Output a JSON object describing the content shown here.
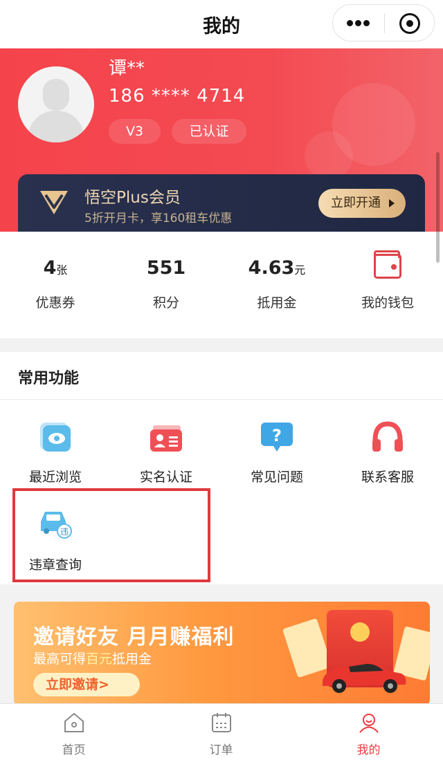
{
  "nav": {
    "title": "我的",
    "more_icon": "more-dots-icon",
    "close_icon": "target-circle-icon"
  },
  "profile": {
    "name": "谭**",
    "phone": "186 **** 4714",
    "level": "V3",
    "verified": "已认证"
  },
  "plus": {
    "title": "悟空Plus会员",
    "subtitle": "5折开月卡，享160租车优惠",
    "button": "立即开通"
  },
  "stats": [
    {
      "value": "4",
      "unit": "张",
      "label": "优惠券"
    },
    {
      "value": "551",
      "unit": "",
      "label": "积分"
    },
    {
      "value": "4.63",
      "unit": "元",
      "label": "抵用金"
    },
    {
      "value": "",
      "unit": "",
      "label": "我的钱包"
    }
  ],
  "functions": {
    "title": "常用功能",
    "items": [
      {
        "label": "最近浏览",
        "icon": "eye-card-icon"
      },
      {
        "label": "实名认证",
        "icon": "id-card-icon"
      },
      {
        "label": "常见问题",
        "icon": "question-bubble-icon"
      },
      {
        "label": "联系客服",
        "icon": "headset-icon"
      },
      {
        "label": "违章查询",
        "icon": "car-violation-icon"
      }
    ]
  },
  "invite": {
    "title": "邀请好友  月月赚福利",
    "subtitle_pre": "最高可得",
    "subtitle_hl": "百元",
    "subtitle_post": "抵用金",
    "button": "立即邀请>"
  },
  "tabbar": [
    {
      "label": "首页",
      "icon": "home-icon",
      "active": false
    },
    {
      "label": "订单",
      "icon": "calendar-icon",
      "active": false
    },
    {
      "label": "我的",
      "icon": "user-icon",
      "active": true
    }
  ],
  "colors": {
    "brand_red": "#f5434b",
    "gold": "#f0d7b3",
    "tab_active": "#f0393f",
    "plus_bg": "#29314f"
  }
}
